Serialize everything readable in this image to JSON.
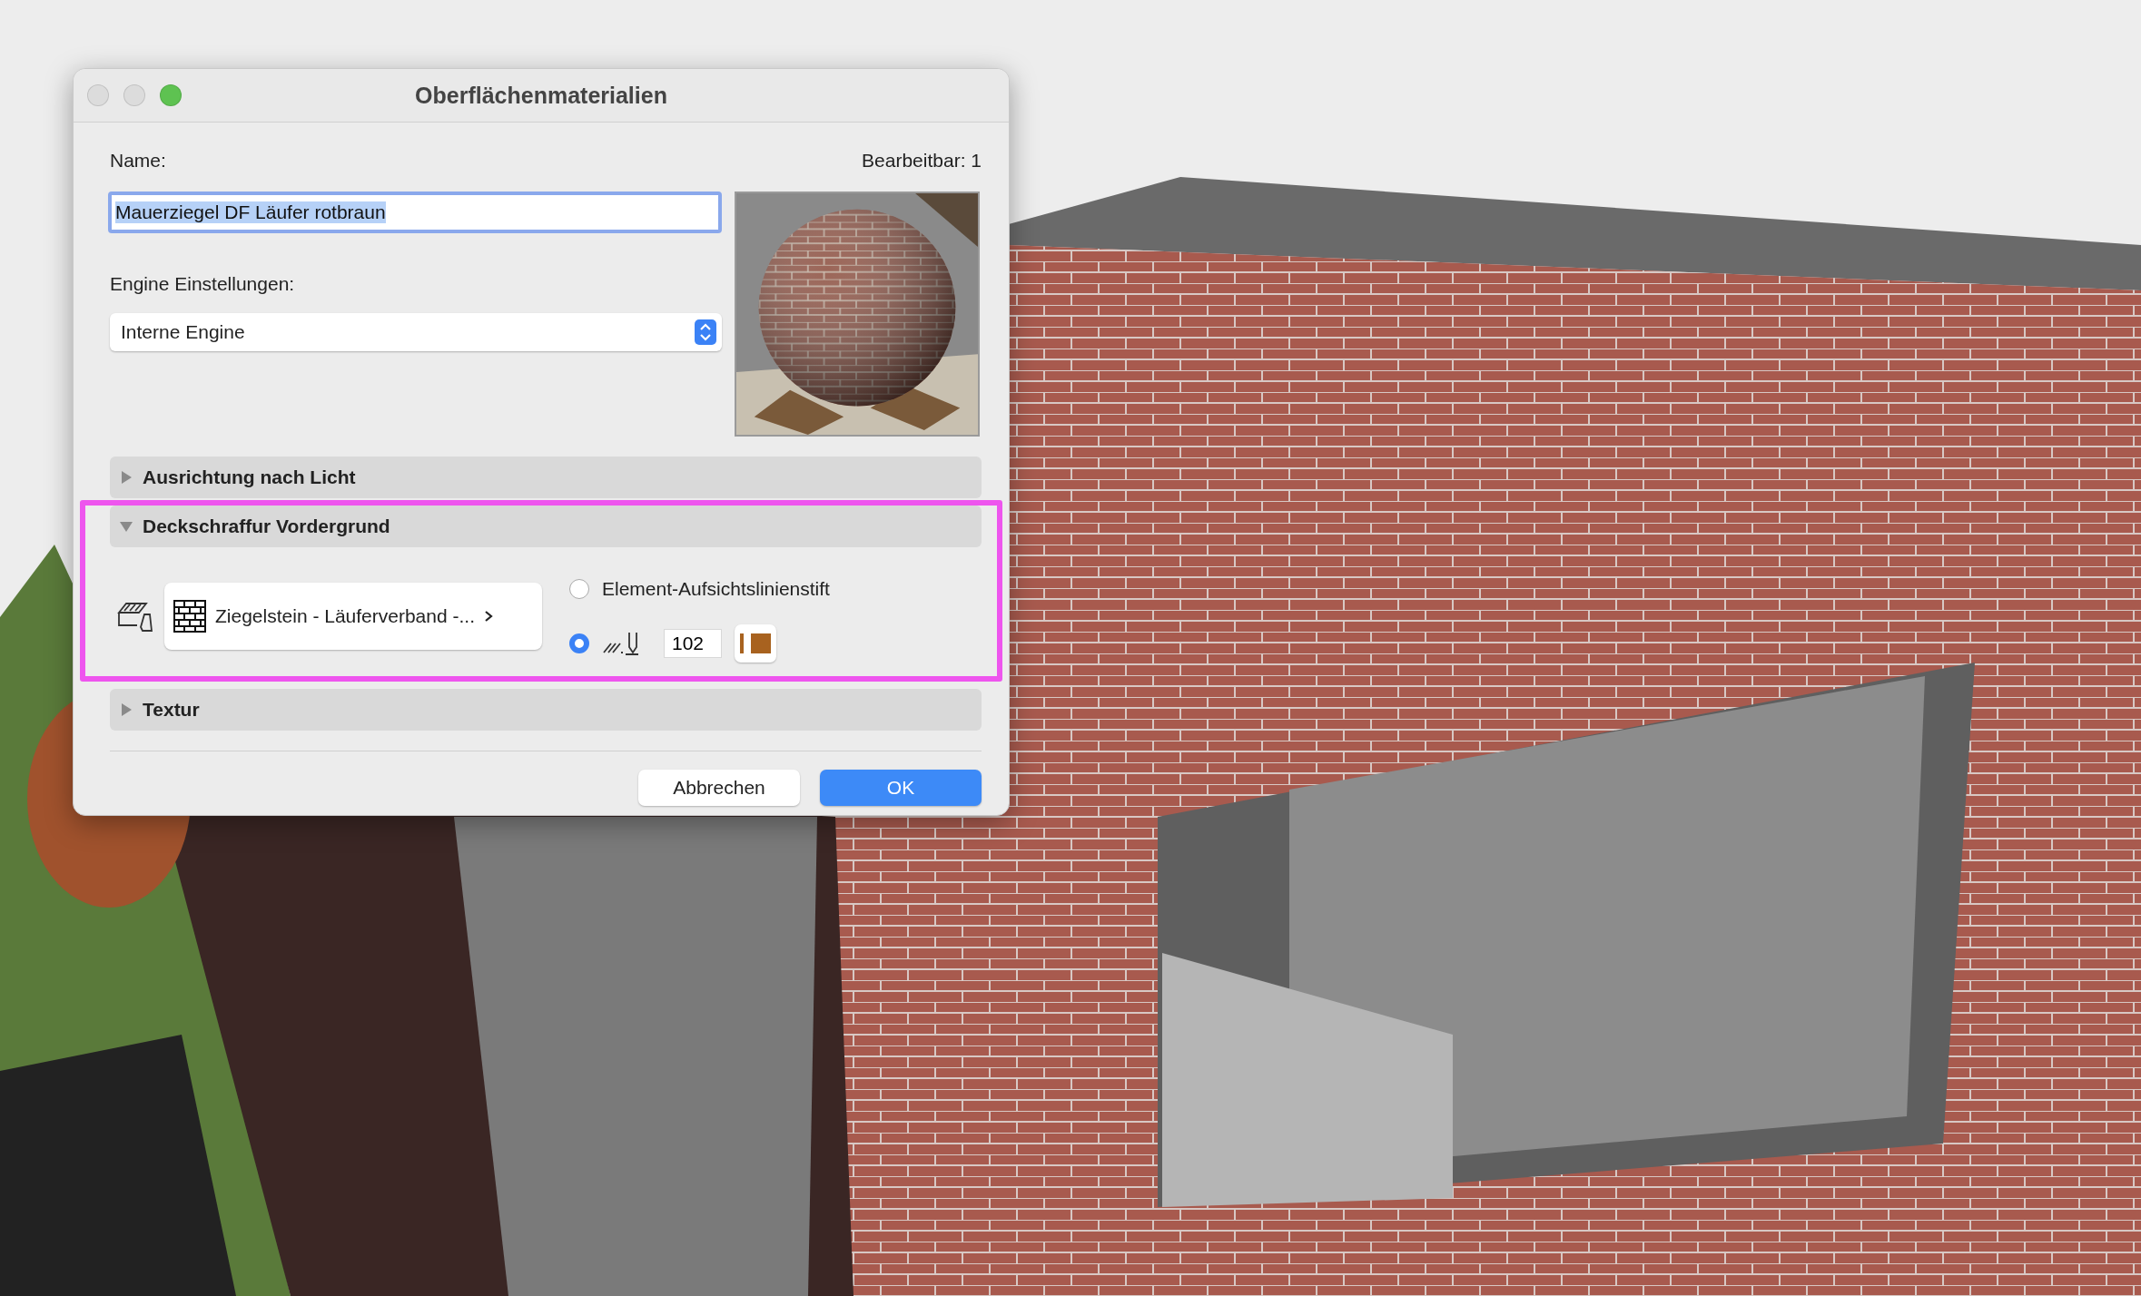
{
  "window": {
    "title": "Oberflächenmaterialien"
  },
  "name": {
    "label": "Name:",
    "value": "Mauerziegel DF Läufer rotbraun"
  },
  "editable": "Bearbeitbar: 1",
  "engine": {
    "label": "Engine Einstellungen:",
    "value": "Interne Engine"
  },
  "sections": [
    {
      "title": "Ausrichtung nach Licht",
      "expanded": false
    },
    {
      "title": "Deckschraffur Vordergrund",
      "expanded": true,
      "fill": "Ziegelstein - Läuferverband -...",
      "pen_options": [
        {
          "kind": "label",
          "label": "Element-Aufsichtslinienstift",
          "selected": false
        },
        {
          "kind": "pen",
          "value": "102",
          "color": "#a8621f",
          "selected": true
        }
      ]
    },
    {
      "title": "Textur",
      "expanded": false
    }
  ],
  "buttons": [
    {
      "label": "Abbrechen",
      "primary": false
    },
    {
      "label": "OK",
      "primary": true
    }
  ]
}
